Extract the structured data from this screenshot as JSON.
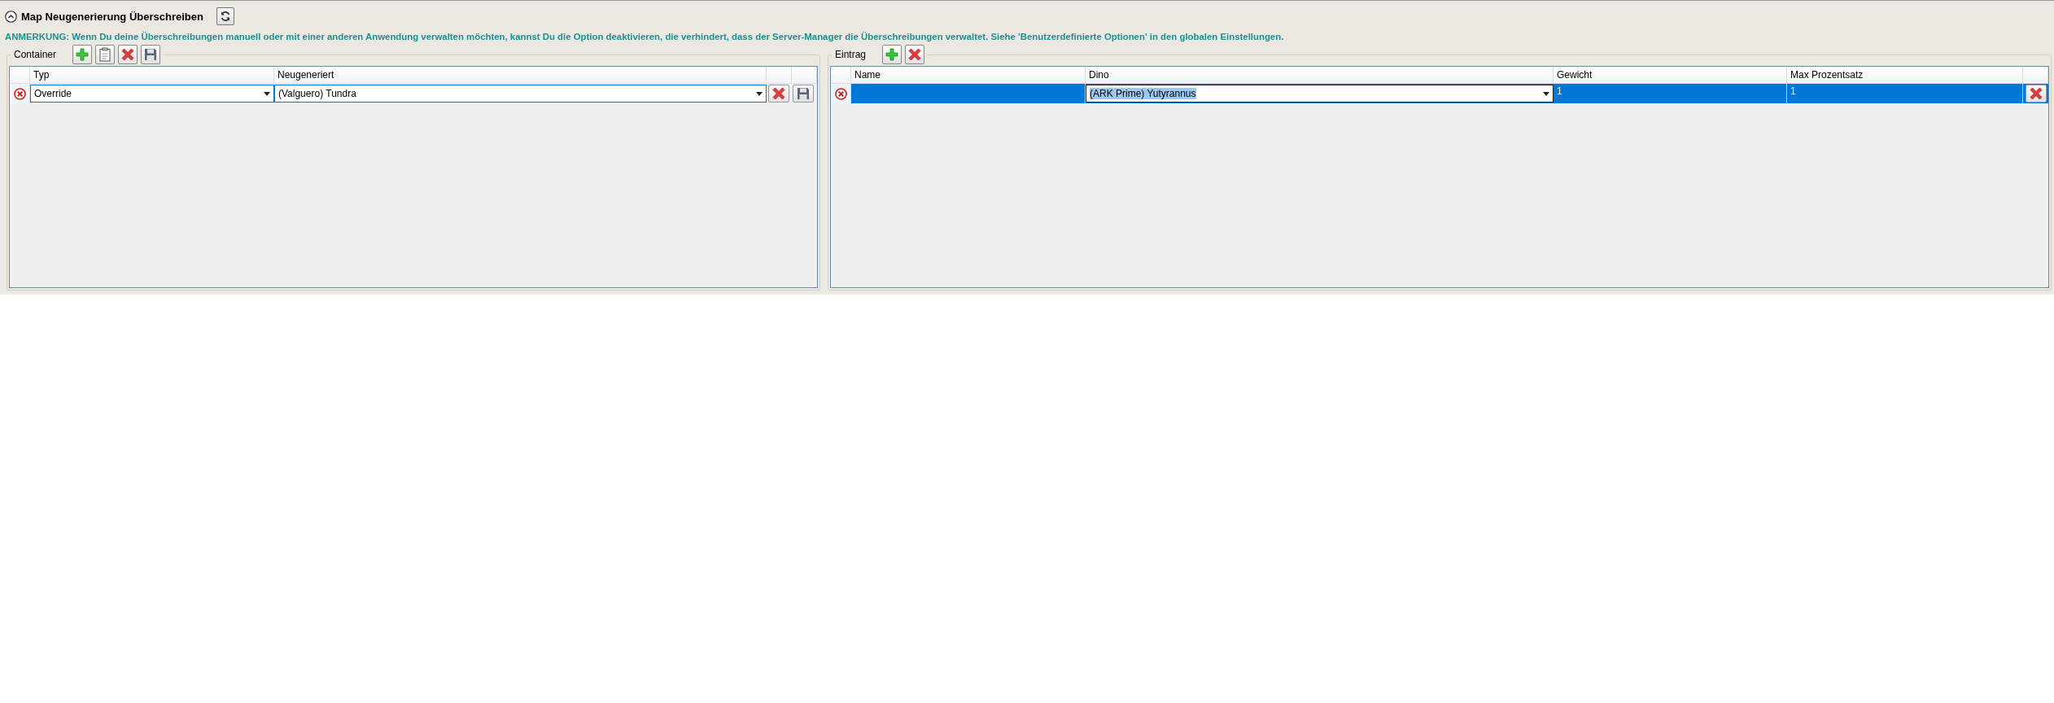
{
  "section": {
    "title": "Map Neugenerierung Überschreiben",
    "expanded": true
  },
  "note": "ANMERKUNG: Wenn Du deine Überschreibungen manuell oder mit einer anderen Anwendung verwalten möchten, kannst Du die Option deaktivieren, die verhindert, dass der Server-Manager die Überschreibungen verwaltet. Siehe 'Benutzerdefinierte Optionen' in den globalen Einstellungen.",
  "panels": [
    {
      "label": "Container",
      "tools": [
        {
          "kind": "add"
        },
        {
          "kind": "paste"
        },
        {
          "kind": "delete"
        },
        {
          "kind": "save"
        }
      ],
      "columns": [
        "Typ",
        "Neugeneriert"
      ],
      "row_actions": [
        {
          "kind": "delete"
        },
        {
          "kind": "save"
        }
      ],
      "rows": [
        {
          "selected": false,
          "cells": [
            {
              "kind": "dropdown",
              "value": "Override"
            },
            {
              "kind": "dropdown",
              "value": "(Valguero) Tundra"
            }
          ]
        }
      ]
    },
    {
      "label": "Eintrag",
      "tools": [
        {
          "kind": "add"
        },
        {
          "kind": "delete"
        }
      ],
      "columns": [
        "Name",
        "Dino",
        "Gewicht",
        "Max Prozentsatz"
      ],
      "row_actions": [
        {
          "kind": "delete"
        }
      ],
      "rows": [
        {
          "selected": true,
          "cells": [
            {
              "kind": "text"
            },
            {
              "kind": "dropdown",
              "value": "(ARK Prime) Yutyrannus"
            },
            {
              "kind": "text",
              "value": "1"
            },
            {
              "kind": "text",
              "value": "1"
            }
          ]
        }
      ]
    }
  ]
}
